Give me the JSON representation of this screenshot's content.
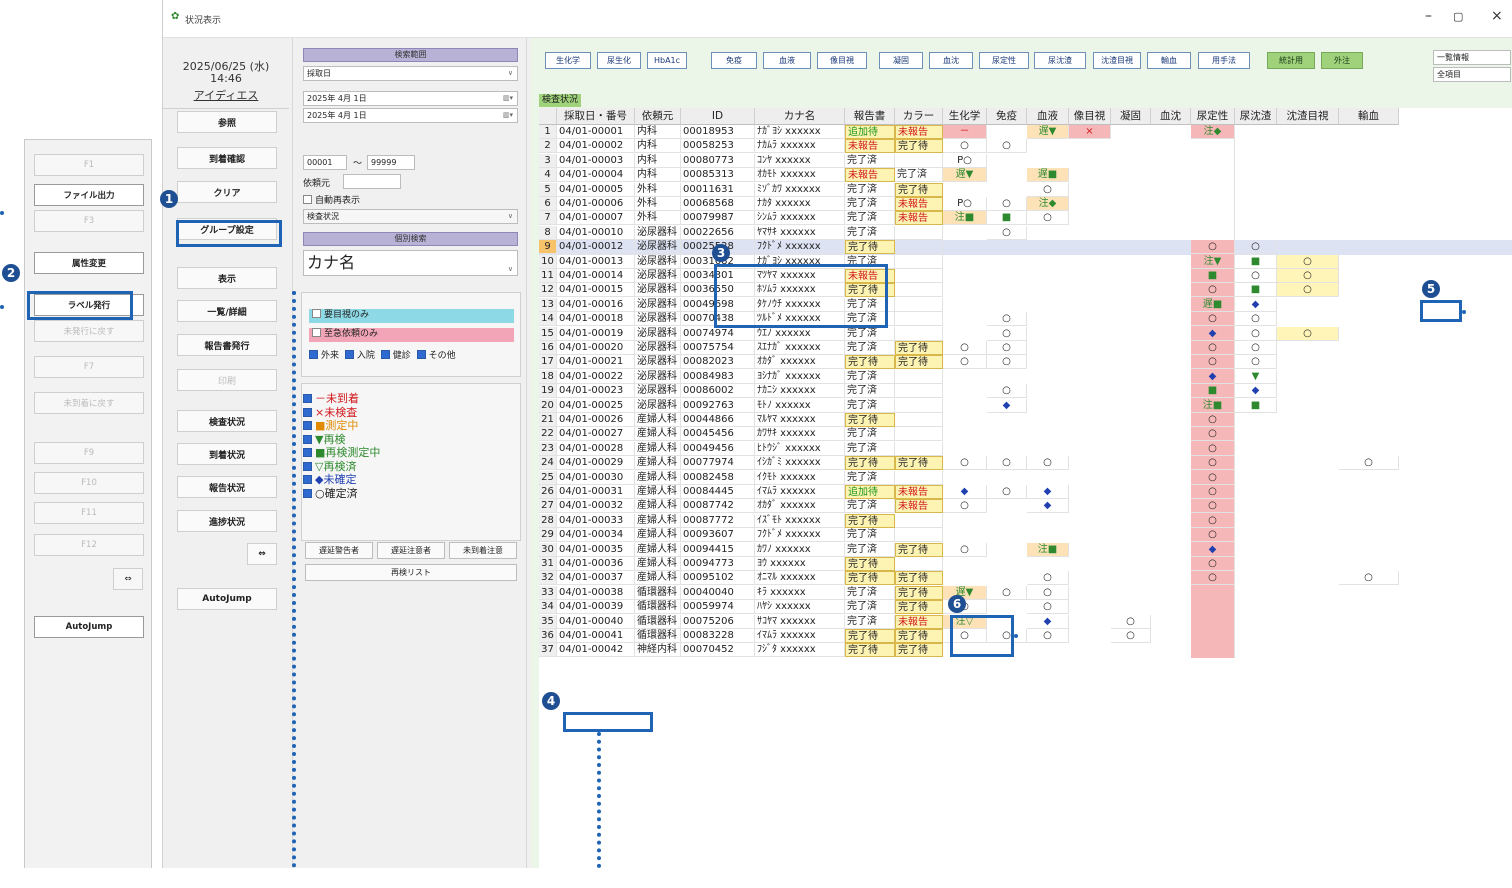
{
  "window_title": "状況表示",
  "date_line": "2025/06/25 (水)",
  "time_line": "14:46",
  "user_name": "アイディエス",
  "fkeys": [
    "F1",
    "ファイル出力",
    "F3",
    "属性変更",
    "ラベル発行",
    "未発行に戻す",
    "F7",
    "未到着に戻す",
    "F9",
    "F10",
    "F11",
    "F12"
  ],
  "autojump": "AutoJump",
  "menu_buttons": [
    "参照",
    "到着確認",
    "クリア",
    "グループ設定",
    "表示",
    "一覧/詳細",
    "報告書発行",
    "印刷",
    "検査状況",
    "到着状況",
    "報告状況",
    "進捗状況"
  ],
  "search": {
    "range_title": "検索範囲",
    "date_field": "採取日",
    "date_from": "2025年 4月 1日",
    "date_to": "2025年 4月 1日",
    "num_from": "00001",
    "tilde": "～",
    "num_to": "99999",
    "requester_label": "依頼元",
    "auto_redisplay": "自動再表示",
    "status_select": "検査状況",
    "individual_title": "個別検索",
    "kana_select": "カナ名",
    "filter_visual": "要目視のみ",
    "filter_urgent": "至急依頼のみ",
    "category_outpatient": "外来",
    "category_inpatient": "入院",
    "category_checkup": "健診",
    "category_other": "その他"
  },
  "legend": [
    {
      "sym": "－",
      "label": "未到着",
      "color": "#d0181c"
    },
    {
      "sym": "×",
      "label": "未検査",
      "color": "#d0181c"
    },
    {
      "sym": "■",
      "label": "測定中",
      "color": "#e08a00"
    },
    {
      "sym": "▼",
      "label": "再検",
      "color": "#2f8a2f"
    },
    {
      "sym": "■",
      "label": "再検測定中",
      "color": "#2f8a2f"
    },
    {
      "sym": "▽",
      "label": "再検済",
      "color": "#2f8a2f"
    },
    {
      "sym": "◆",
      "label": "未確定",
      "color": "#2040b0"
    },
    {
      "sym": "○",
      "label": "確定済",
      "color": "#222222"
    }
  ],
  "delay_buttons": [
    "遅延警告者",
    "遅延注意者",
    "未到着注意"
  ],
  "recheck_list": "再検リスト",
  "tabs": [
    {
      "label": "生化学",
      "green": false
    },
    {
      "label": "尿生化",
      "green": false
    },
    {
      "label": "HbA1c",
      "green": false
    },
    {
      "label": "免疫",
      "green": false
    },
    {
      "label": "血液",
      "green": false
    },
    {
      "label": "像目視",
      "green": false
    },
    {
      "label": "凝固",
      "green": false
    },
    {
      "label": "血沈",
      "green": false
    },
    {
      "label": "尿定性",
      "green": false
    },
    {
      "label": "尿沈渣",
      "green": false
    },
    {
      "label": "沈渣目視",
      "green": false
    },
    {
      "label": "輸血",
      "green": false
    },
    {
      "label": "用手法",
      "green": false
    },
    {
      "label": "統計用",
      "green": true
    },
    {
      "label": "外注",
      "green": true
    }
  ],
  "list_info": "一覧情報",
  "all_items": "全項目",
  "status_label": "検査状況",
  "columns": [
    "採取日・番号",
    "依頼元",
    "ID",
    "カナ名",
    "報告書",
    "カラー",
    "生化学",
    "免疫",
    "血液",
    "像目視",
    "凝固",
    "血沈",
    "尿定性",
    "尿沈渣",
    "沈渣目視",
    "輸血"
  ],
  "rows": [
    {
      "n": "1",
      "no": "04/01-00001",
      "dept": "内科",
      "id": "00018953",
      "kana": "ﾅｶﾞﾖｼ xxxxxx",
      "rep": "追加待",
      "col": "未報告"
    },
    {
      "n": "2",
      "no": "04/01-00002",
      "dept": "内科",
      "id": "00058253",
      "kana": "ﾅｶﾑﾗ xxxxxx",
      "rep": "未報告",
      "col": "完了待"
    },
    {
      "n": "3",
      "no": "04/01-00003",
      "dept": "内科",
      "id": "00080773",
      "kana": "ｺﾝﾔ xxxxxx",
      "rep": "完了済",
      "col": ""
    },
    {
      "n": "4",
      "no": "04/01-00004",
      "dept": "内科",
      "id": "00085313",
      "kana": "ｵｶﾓﾄ xxxxxx",
      "rep": "未報告",
      "col": "完了済"
    },
    {
      "n": "5",
      "no": "04/01-00005",
      "dept": "外科",
      "id": "00011631",
      "kana": "ﾐｿﾞｶﾜ xxxxxx",
      "rep": "完了済",
      "col": "完了待"
    },
    {
      "n": "6",
      "no": "04/01-00006",
      "dept": "外科",
      "id": "00068568",
      "kana": "ﾅｶﾀ xxxxxx",
      "rep": "完了済",
      "col": "未報告"
    },
    {
      "n": "7",
      "no": "04/01-00007",
      "dept": "外科",
      "id": "00079987",
      "kana": "ｼﾝﾑﾗ xxxxxx",
      "rep": "完了済",
      "col": "未報告"
    },
    {
      "n": "8",
      "no": "04/01-00010",
      "dept": "泌尿器科",
      "id": "00022656",
      "kana": "ﾔﾏｻｷ xxxxxx",
      "rep": "完了済",
      "col": ""
    },
    {
      "n": "9",
      "no": "04/01-00012",
      "dept": "泌尿器科",
      "id": "00025528",
      "kana": "ﾌｸﾄﾞﾒ xxxxxx",
      "rep": "完了待",
      "col": ""
    },
    {
      "n": "10",
      "no": "04/01-00013",
      "dept": "泌尿器科",
      "id": "00031682",
      "kana": "ﾅｶﾞﾖｼ xxxxxx",
      "rep": "完了済",
      "col": ""
    },
    {
      "n": "11",
      "no": "04/01-00014",
      "dept": "泌尿器科",
      "id": "00034301",
      "kana": "ﾏﾂﾔﾏ xxxxxx",
      "rep": "未報告",
      "col": ""
    },
    {
      "n": "12",
      "no": "04/01-00015",
      "dept": "泌尿器科",
      "id": "00036550",
      "kana": "ﾎｿﾑﾗ xxxxxx",
      "rep": "完了待",
      "col": ""
    },
    {
      "n": "13",
      "no": "04/01-00016",
      "dept": "泌尿器科",
      "id": "00049698",
      "kana": "ﾀｹﾉｳﾁ xxxxxx",
      "rep": "完了済",
      "col": ""
    },
    {
      "n": "14",
      "no": "04/01-00018",
      "dept": "泌尿器科",
      "id": "00070438",
      "kana": "ﾂﾙﾄﾞﾒ xxxxxx",
      "rep": "完了済",
      "col": ""
    },
    {
      "n": "15",
      "no": "04/01-00019",
      "dept": "泌尿器科",
      "id": "00074974",
      "kana": "ｳｴﾉ xxxxxx",
      "rep": "完了済",
      "col": ""
    },
    {
      "n": "16",
      "no": "04/01-00020",
      "dept": "泌尿器科",
      "id": "00075754",
      "kana": "ｽｴﾅｶﾞ xxxxxx",
      "rep": "完了済",
      "col": "完了待"
    },
    {
      "n": "17",
      "no": "04/01-00021",
      "dept": "泌尿器科",
      "id": "00082023",
      "kana": "ｵｶﾀﾞ xxxxxx",
      "rep": "完了待",
      "col": "完了待"
    },
    {
      "n": "18",
      "no": "04/01-00022",
      "dept": "泌尿器科",
      "id": "00084983",
      "kana": "ﾖｼﾅｶﾞ xxxxxx",
      "rep": "完了済",
      "col": ""
    },
    {
      "n": "19",
      "no": "04/01-00023",
      "dept": "泌尿器科",
      "id": "00086002",
      "kana": "ﾅｶﾆｼ xxxxxx",
      "rep": "完了済",
      "col": ""
    },
    {
      "n": "20",
      "no": "04/01-00025",
      "dept": "泌尿器科",
      "id": "00092763",
      "kana": "ﾓﾄﾉ xxxxxx",
      "rep": "完了済",
      "col": ""
    },
    {
      "n": "21",
      "no": "04/01-00026",
      "dept": "産婦人科",
      "id": "00044866",
      "kana": "ﾏﾙﾔﾏ xxxxxx",
      "rep": "完了待",
      "col": ""
    },
    {
      "n": "22",
      "no": "04/01-00027",
      "dept": "産婦人科",
      "id": "00045456",
      "kana": "ｶﾜｻｷ xxxxxx",
      "rep": "完了済",
      "col": ""
    },
    {
      "n": "23",
      "no": "04/01-00028",
      "dept": "産婦人科",
      "id": "00049456",
      "kana": "ﾋﾄｳｼﾞ xxxxxx",
      "rep": "完了済",
      "col": ""
    },
    {
      "n": "24",
      "no": "04/01-00029",
      "dept": "産婦人科",
      "id": "00077974",
      "kana": "ｲｼｶﾞﾐ xxxxxx",
      "rep": "完了待",
      "col": "完了待"
    },
    {
      "n": "25",
      "no": "04/01-00030",
      "dept": "産婦人科",
      "id": "00082458",
      "kana": "ｲｸﾓﾄ xxxxxx",
      "rep": "完了済",
      "col": ""
    },
    {
      "n": "26",
      "no": "04/01-00031",
      "dept": "産婦人科",
      "id": "00084445",
      "kana": "ｲﾏﾑﾗ xxxxxx",
      "rep": "追加待",
      "col": "未報告"
    },
    {
      "n": "27",
      "no": "04/01-00032",
      "dept": "産婦人科",
      "id": "00087742",
      "kana": "ｵｶﾀﾞ xxxxxx",
      "rep": "完了済",
      "col": "未報告"
    },
    {
      "n": "28",
      "no": "04/01-00033",
      "dept": "産婦人科",
      "id": "00087772",
      "kana": "ｲｽﾞﾓﾄ xxxxxx",
      "rep": "完了待",
      "col": ""
    },
    {
      "n": "29",
      "no": "04/01-00034",
      "dept": "産婦人科",
      "id": "00093607",
      "kana": "ﾌｸﾄﾞﾒ xxxxxx",
      "rep": "完了済",
      "col": ""
    },
    {
      "n": "30",
      "no": "04/01-00035",
      "dept": "産婦人科",
      "id": "00094415",
      "kana": "ｶﾜﾉ xxxxxx",
      "rep": "完了済",
      "col": "完了待"
    },
    {
      "n": "31",
      "no": "04/01-00036",
      "dept": "産婦人科",
      "id": "00094773",
      "kana": "ﾖｳ xxxxxx",
      "rep": "完了待",
      "col": ""
    },
    {
      "n": "32",
      "no": "04/01-00037",
      "dept": "産婦人科",
      "id": "00095102",
      "kana": "ｵﾆﾏﾙ xxxxxx",
      "rep": "完了待",
      "col": "完了待"
    },
    {
      "n": "33",
      "no": "04/01-00038",
      "dept": "循環器科",
      "id": "00040040",
      "kana": "ｷﾗ xxxxxx",
      "rep": "完了済",
      "col": "完了待"
    },
    {
      "n": "34",
      "no": "04/01-00039",
      "dept": "循環器科",
      "id": "00059974",
      "kana": "ﾊﾔｼ xxxxxx",
      "rep": "完了済",
      "col": "完了待"
    },
    {
      "n": "35",
      "no": "04/01-00040",
      "dept": "循環器科",
      "id": "00075206",
      "kana": "ｻｺﾔﾏ xxxxxx",
      "rep": "完了済",
      "col": "未報告"
    },
    {
      "n": "36",
      "no": "04/01-00041",
      "dept": "循環器科",
      "id": "00083228",
      "kana": "ｲﾏﾑﾗ xxxxxx",
      "rep": "完了待",
      "col": "完了待"
    },
    {
      "n": "37",
      "no": "04/01-00042",
      "dept": "神経内科",
      "id": "00070452",
      "kana": "ﾌｼﾞﾀ xxxxxx",
      "rep": "完了待",
      "col": "完了待"
    }
  ],
  "marks": [
    [
      1,
      6,
      "－",
      "red"
    ],
    [
      1,
      8,
      "遅▼",
      "mix"
    ],
    [
      1,
      9,
      "×",
      "red"
    ],
    [
      1,
      12,
      "注◆",
      "mix"
    ],
    [
      2,
      6,
      "○",
      ""
    ],
    [
      2,
      7,
      "○",
      ""
    ],
    [
      3,
      6,
      "P○",
      ""
    ],
    [
      4,
      6,
      "遅▼",
      "mix"
    ],
    [
      4,
      8,
      "遅■",
      "mix"
    ],
    [
      5,
      8,
      "○",
      ""
    ],
    [
      6,
      6,
      "P○",
      ""
    ],
    [
      6,
      7,
      "○",
      ""
    ],
    [
      6,
      8,
      "注◆",
      "mix"
    ],
    [
      7,
      6,
      "注■",
      "mix"
    ],
    [
      7,
      7,
      "■",
      "g"
    ],
    [
      7,
      8,
      "○",
      ""
    ],
    [
      8,
      7,
      "○",
      ""
    ],
    [
      9,
      12,
      "○",
      ""
    ],
    [
      9,
      13,
      "○",
      ""
    ],
    [
      10,
      12,
      "注▼",
      "mix"
    ],
    [
      10,
      13,
      "■",
      "g"
    ],
    [
      10,
      14,
      "○",
      ""
    ],
    [
      11,
      12,
      "■",
      "g"
    ],
    [
      11,
      13,
      "○",
      ""
    ],
    [
      11,
      14,
      "○",
      ""
    ],
    [
      12,
      12,
      "○",
      ""
    ],
    [
      12,
      13,
      "■",
      "g"
    ],
    [
      12,
      14,
      "○",
      ""
    ],
    [
      13,
      12,
      "遅■",
      "mix"
    ],
    [
      13,
      13,
      "◆",
      "b"
    ],
    [
      14,
      7,
      "○",
      ""
    ],
    [
      14,
      12,
      "○",
      ""
    ],
    [
      14,
      13,
      "○",
      ""
    ],
    [
      15,
      7,
      "○",
      ""
    ],
    [
      15,
      12,
      "◆",
      "b"
    ],
    [
      15,
      13,
      "○",
      ""
    ],
    [
      15,
      14,
      "○",
      ""
    ],
    [
      16,
      6,
      "○",
      ""
    ],
    [
      16,
      7,
      "○",
      ""
    ],
    [
      16,
      12,
      "○",
      ""
    ],
    [
      16,
      13,
      "○",
      ""
    ],
    [
      17,
      6,
      "○",
      ""
    ],
    [
      17,
      7,
      "○",
      ""
    ],
    [
      17,
      12,
      "○",
      ""
    ],
    [
      17,
      13,
      "○",
      ""
    ],
    [
      18,
      12,
      "◆",
      "b"
    ],
    [
      18,
      13,
      "▼",
      "g"
    ],
    [
      19,
      7,
      "○",
      ""
    ],
    [
      19,
      12,
      "■",
      "g"
    ],
    [
      19,
      13,
      "◆",
      "b"
    ],
    [
      20,
      7,
      "◆",
      "b"
    ],
    [
      20,
      12,
      "注■",
      "mix"
    ],
    [
      20,
      13,
      "■",
      "g"
    ],
    [
      21,
      12,
      "○",
      ""
    ],
    [
      22,
      12,
      "○",
      ""
    ],
    [
      23,
      12,
      "○",
      ""
    ],
    [
      24,
      6,
      "○",
      ""
    ],
    [
      24,
      7,
      "○",
      ""
    ],
    [
      24,
      8,
      "○",
      ""
    ],
    [
      24,
      12,
      "○",
      ""
    ],
    [
      24,
      15,
      "○",
      ""
    ],
    [
      25,
      12,
      "○",
      ""
    ],
    [
      26,
      6,
      "◆",
      "b"
    ],
    [
      26,
      7,
      "○",
      ""
    ],
    [
      26,
      8,
      "◆",
      "b"
    ],
    [
      26,
      12,
      "○",
      ""
    ],
    [
      27,
      6,
      "○",
      ""
    ],
    [
      27,
      8,
      "◆",
      "b"
    ],
    [
      27,
      12,
      "○",
      ""
    ],
    [
      28,
      12,
      "○",
      ""
    ],
    [
      29,
      12,
      "○",
      ""
    ],
    [
      30,
      6,
      "○",
      ""
    ],
    [
      30,
      8,
      "注■",
      "mix"
    ],
    [
      30,
      12,
      "◆",
      "b"
    ],
    [
      31,
      12,
      "○",
      ""
    ],
    [
      32,
      8,
      "○",
      ""
    ],
    [
      32,
      12,
      "○",
      ""
    ],
    [
      32,
      15,
      "○",
      ""
    ],
    [
      33,
      6,
      "遅▼",
      "mix"
    ],
    [
      33,
      7,
      "○",
      ""
    ],
    [
      33,
      8,
      "○",
      ""
    ],
    [
      34,
      6,
      "○",
      ""
    ],
    [
      34,
      8,
      "○",
      ""
    ],
    [
      35,
      6,
      "注▽",
      "mix"
    ],
    [
      35,
      8,
      "◆",
      "b"
    ],
    [
      35,
      10,
      "○",
      ""
    ],
    [
      36,
      6,
      "○",
      ""
    ],
    [
      36,
      7,
      "○",
      ""
    ],
    [
      36,
      8,
      "○",
      ""
    ],
    [
      36,
      10,
      "○",
      ""
    ]
  ],
  "badges": [
    "1",
    "2",
    "3",
    "4",
    "5",
    "6"
  ],
  "colors": {
    "accent": "#1f63b5",
    "badge": "#1f4f93",
    "tab_green": "#9fd27a",
    "header_purple": "#b7b2d6",
    "pink_cell": "#f5b7b7"
  }
}
